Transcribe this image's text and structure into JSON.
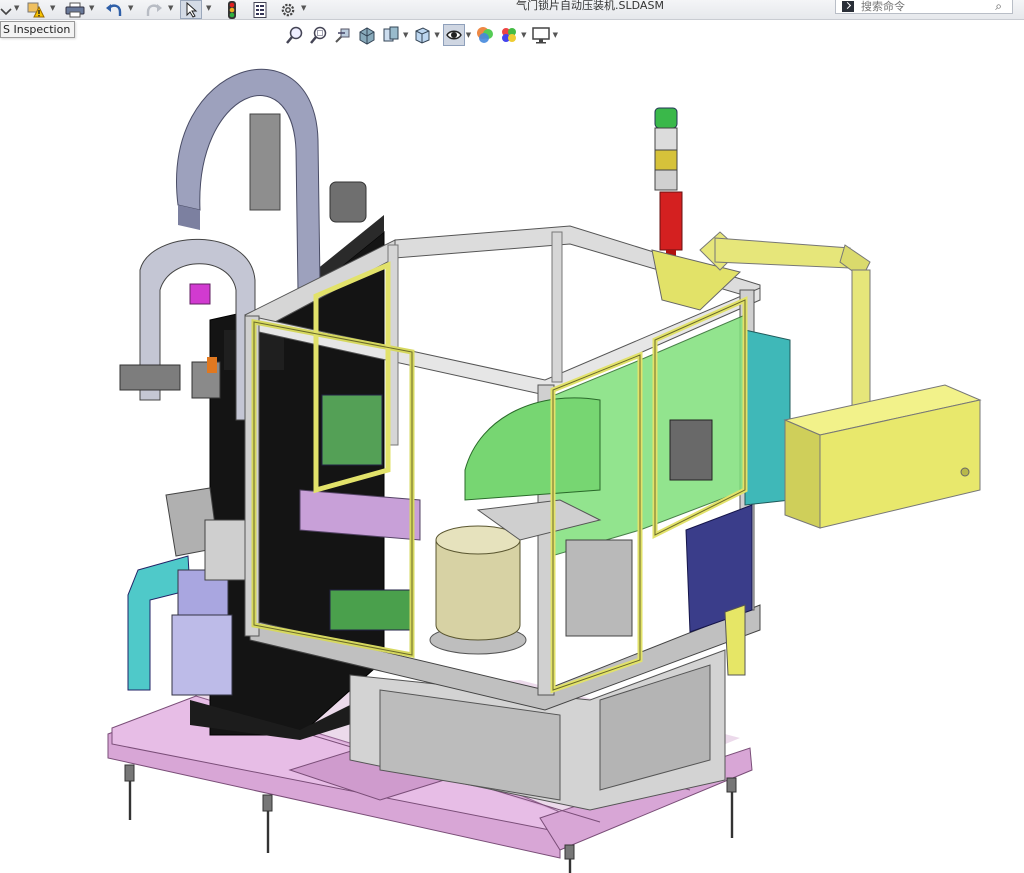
{
  "document": {
    "title": "气门锁片自动压装机.SLDASM"
  },
  "search": {
    "placeholder": "搜索命令"
  },
  "tooltip": {
    "text": "S Inspection"
  },
  "toolbar": {
    "items": [
      "options-icon",
      "rebuild-warning-icon",
      "print-icon",
      "undo-icon",
      "redo-icon",
      "select-icon",
      "traffic-light-icon",
      "file-properties-icon",
      "settings-icon"
    ]
  },
  "view_toolbar": {
    "items": [
      "zoom-to-fit-icon",
      "zoom-to-area-icon",
      "previous-view-icon",
      "section-view-icon",
      "dynamic-annotation-icon",
      "view-orientation-icon",
      "display-style-icon",
      "hide-show-items-icon",
      "edit-appearance-icon",
      "apply-scene-icon",
      "view-settings-icon"
    ]
  },
  "colors": {
    "frame": "#c8ccd2",
    "panel_yellow": "#e8e86a",
    "base_pink": "#d9a8d8",
    "column_black": "#151515",
    "cable_chain": "#9a9eb8",
    "guard_green": "#7ce07a",
    "bowl": "#d8d3a6",
    "arm_yellow": "#e6e67a",
    "monitor_navy": "#3a3d8a",
    "motor_cyan": "#4fc7c7",
    "lamp_green": "#3ab84a",
    "lamp_yellow": "#d6c23a",
    "lamp_red": "#d42020"
  }
}
